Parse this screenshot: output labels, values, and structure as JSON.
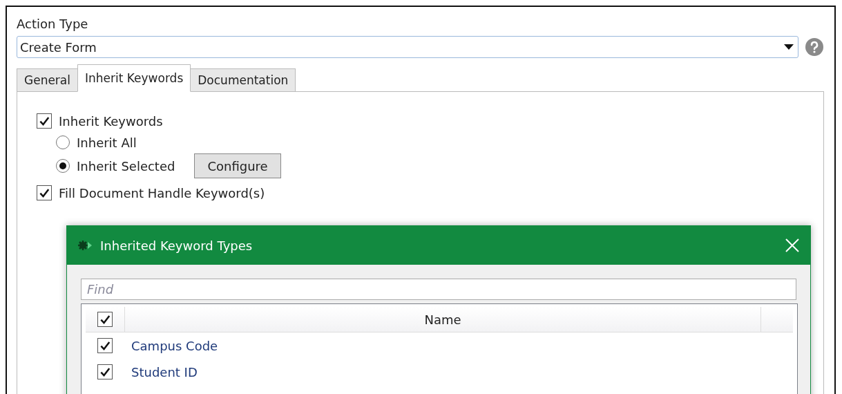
{
  "action_type": {
    "label": "Action Type",
    "value": "Create Form"
  },
  "tabs": [
    {
      "label": "General",
      "selected": false
    },
    {
      "label": "Inherit Keywords",
      "selected": true
    },
    {
      "label": "Documentation",
      "selected": false
    }
  ],
  "inherit_keywords": {
    "label": "Inherit Keywords",
    "checked": true
  },
  "inherit_modes": [
    {
      "label": "Inherit All",
      "selected": false
    },
    {
      "label": "Inherit Selected",
      "selected": true
    }
  ],
  "configure_button": "Configure",
  "fill_handle": {
    "label": "Fill Document Handle Keyword(s)",
    "checked": true
  },
  "dialog": {
    "title": "Inherited Keyword Types",
    "find": {
      "placeholder": "Find"
    },
    "table": {
      "select_all_checked": true,
      "columns": [
        "Name"
      ],
      "rows": [
        {
          "name": "Campus Code",
          "checked": true
        },
        {
          "name": "Student ID",
          "checked": true
        }
      ]
    }
  }
}
